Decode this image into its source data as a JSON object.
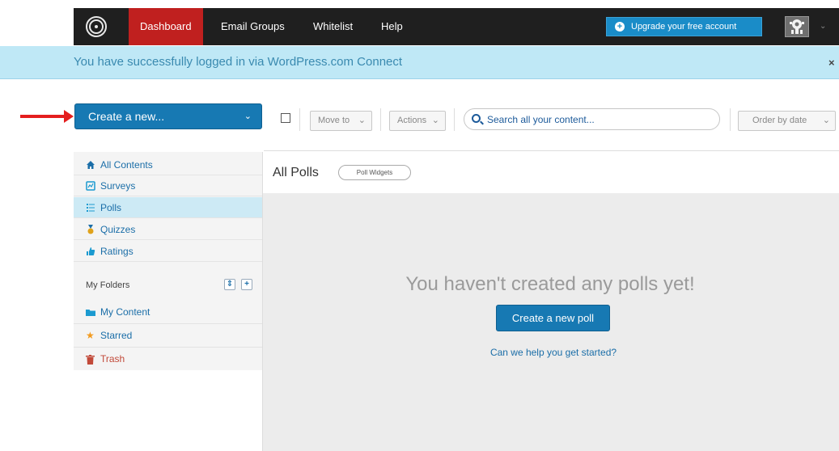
{
  "topbar": {
    "nav": [
      {
        "label": "Dashboard",
        "active": true
      },
      {
        "label": "Email Groups",
        "active": false
      },
      {
        "label": "Whitelist",
        "active": false
      },
      {
        "label": "Help",
        "active": false
      }
    ],
    "upgrade_label": "Upgrade your free account",
    "upgrade_icon": "plus-circle-icon",
    "user_icon": "robot-avatar-icon"
  },
  "notice": {
    "text": "You have successfully logged in via WordPress.com Connect",
    "close": "×"
  },
  "create_new": {
    "label": "Create a new...",
    "chevron": "⌄"
  },
  "toolbar": {
    "move_to": "Move to",
    "actions": "Actions",
    "search_placeholder": "Search all your content...",
    "order": "Order by date"
  },
  "sidebar": {
    "items": [
      {
        "label": "All Contents",
        "icon": "home-icon"
      },
      {
        "label": "Surveys",
        "icon": "survey-icon"
      },
      {
        "label": "Polls",
        "icon": "poll-list-icon",
        "active": true
      },
      {
        "label": "Quizzes",
        "icon": "medal-icon"
      },
      {
        "label": "Ratings",
        "icon": "thumbs-up-icon"
      }
    ],
    "folders_title": "My Folders",
    "folders": [
      {
        "label": "My Content",
        "icon": "folder-icon"
      },
      {
        "label": "Starred",
        "icon": "star-icon"
      },
      {
        "label": "Trash",
        "icon": "trash-icon"
      }
    ]
  },
  "main": {
    "title": "All Polls",
    "widgets_pill": "Poll Widgets",
    "empty_message": "You haven't created any polls yet!",
    "create_button": "Create a new poll",
    "help_link": "Can we help you get started?"
  },
  "colors": {
    "topbar": "#1f1f1f",
    "active_nav": "#c0201f",
    "primary_button": "#1779b3",
    "notice_bg": "#bfe8f6",
    "arrow": "#e41e1e"
  }
}
